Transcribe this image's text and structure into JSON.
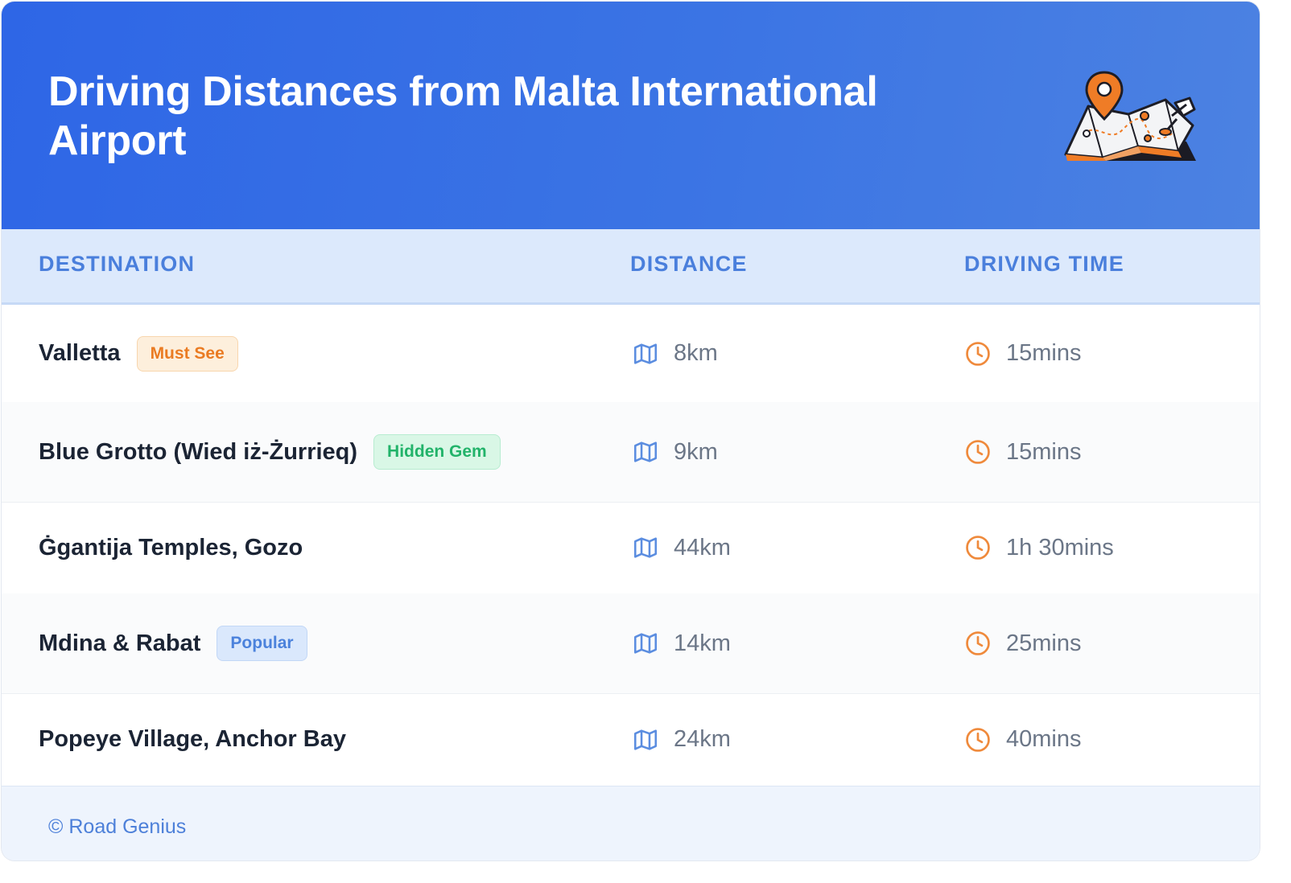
{
  "header": {
    "title": "Driving Distances from Malta International Airport",
    "illustration_icon": "map-with-pins-icon"
  },
  "table": {
    "columns": [
      "DESTINATION",
      "DISTANCE",
      "DRIVING TIME"
    ],
    "rows": [
      {
        "destination": "Valletta",
        "badge": "Must See",
        "badge_type": "must",
        "distance": "8km",
        "time": "15mins"
      },
      {
        "destination": "Blue Grotto (Wied iż-Żurrieq)",
        "badge": "Hidden Gem",
        "badge_type": "hidden",
        "distance": "9km",
        "time": "15mins"
      },
      {
        "destination": "Ġgantija Temples, Gozo",
        "badge": "",
        "badge_type": "",
        "distance": "44km",
        "time": "1h 30mins"
      },
      {
        "destination": "Mdina & Rabat",
        "badge": "Popular",
        "badge_type": "popular",
        "distance": "14km",
        "time": "25mins"
      },
      {
        "destination": "Popeye Village, Anchor Bay",
        "badge": "",
        "badge_type": "",
        "distance": "24km",
        "time": "40mins"
      }
    ]
  },
  "icons": {
    "distance": "map-icon",
    "time": "clock-icon"
  },
  "colors": {
    "header_blue": "#2e66e6",
    "accent_blue": "#4a7fdc",
    "accent_orange": "#ea7b22",
    "accent_green": "#22b36a"
  },
  "footer": {
    "credit": "© Road Genius"
  }
}
